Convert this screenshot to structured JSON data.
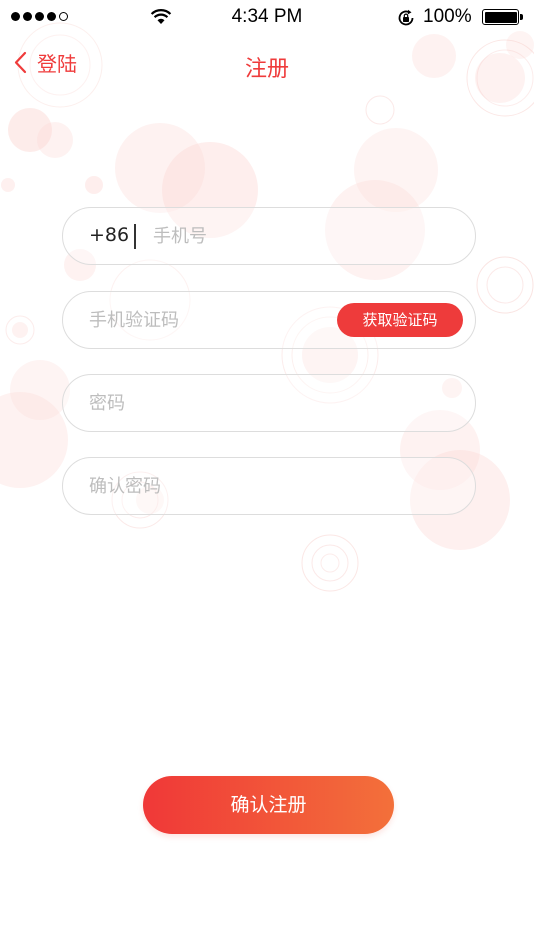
{
  "status_bar": {
    "time": "4:34 PM",
    "battery": "100%",
    "signal_icon": "signal-dots-icon",
    "wifi_icon": "wifi-icon",
    "lock_icon": "rotation-lock-icon",
    "battery_icon": "battery-icon"
  },
  "nav": {
    "back_label": "登陆",
    "back_icon": "chevron-left-icon",
    "title": "注册"
  },
  "form": {
    "country_code": "+86",
    "phone_placeholder": "手机号",
    "code_placeholder": "手机验证码",
    "get_code_label": "获取验证码",
    "password_placeholder": "密码",
    "confirm_password_placeholder": "确认密码"
  },
  "submit_label": "确认注册",
  "colors": {
    "accent": "#ee3b3b",
    "gradient_end": "#f3703a",
    "field_border": "#dddddd",
    "placeholder": "#bdbdbd"
  }
}
